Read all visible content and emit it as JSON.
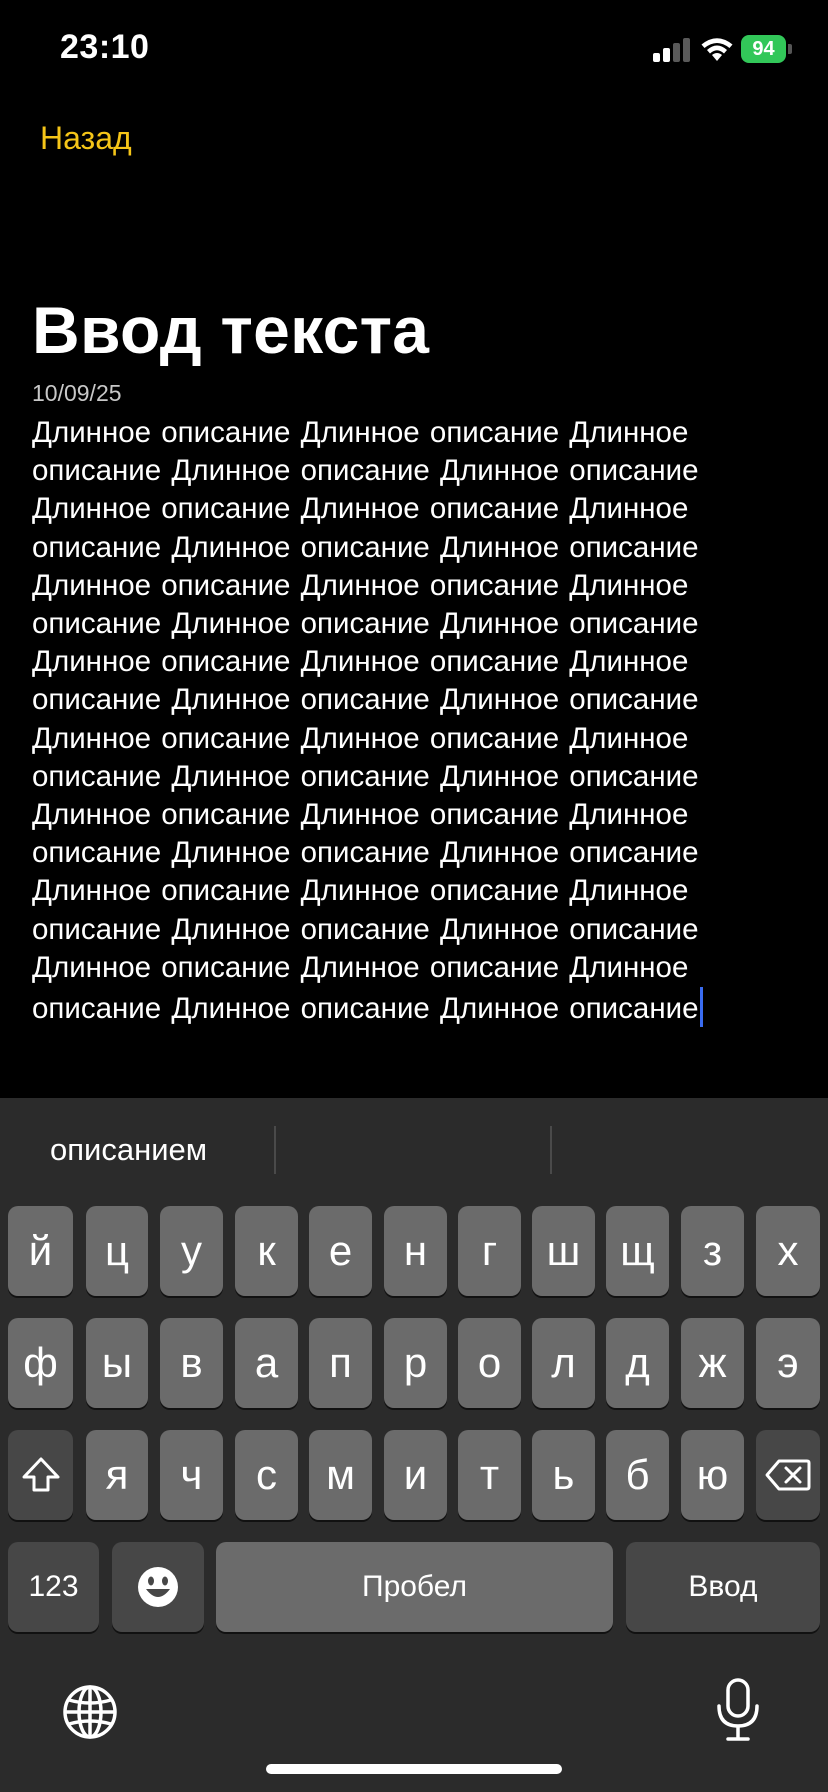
{
  "status_bar": {
    "time": "23:10",
    "battery_percent": "94",
    "signal_icon": "cellular-signal-icon",
    "wifi_icon": "wifi-icon",
    "battery_color": "#32c759"
  },
  "nav": {
    "back_label": "Назад",
    "accent_color": "#f5c518"
  },
  "note": {
    "title": "Ввод текста",
    "date": "10/09/25",
    "body": "Длинное описание Длинное описание Длинное описание Длинное описание Длинное описание Длинное описание Длинное описание Длинное описание Длинное описание Длинное описание Длинное описание Длинное описание Длинное описание Длинное описание Длинное описание Длинное описание Длинное описание Длинное описание Длинное описание Длинное описание Длинное описание Длинное описание Длинное описание Длинное описание Длинное описание Длинное описание Длинное описание Длинное описание Длинное описание Длинное описание Длинное описание Длинное описание Длинное описание Длинное описание Длинное описание Длинное описание Длинное описание Длинное описание Длинное описание Длинное описание"
  },
  "keyboard": {
    "suggestions": [
      "описанием",
      "",
      ""
    ],
    "row1": [
      "й",
      "ц",
      "у",
      "к",
      "е",
      "н",
      "г",
      "ш",
      "щ",
      "з",
      "х"
    ],
    "row2": [
      "ф",
      "ы",
      "в",
      "а",
      "п",
      "р",
      "о",
      "л",
      "д",
      "ж",
      "э"
    ],
    "row3": [
      "я",
      "ч",
      "с",
      "м",
      "и",
      "т",
      "ь",
      "б",
      "ю"
    ],
    "numbers_label": "123",
    "space_label": "Пробел",
    "return_label": "Ввод",
    "icons": {
      "shift": "shift-icon",
      "backspace": "backspace-icon",
      "emoji": "emoji-icon",
      "globe": "globe-icon",
      "mic": "microphone-icon"
    }
  }
}
